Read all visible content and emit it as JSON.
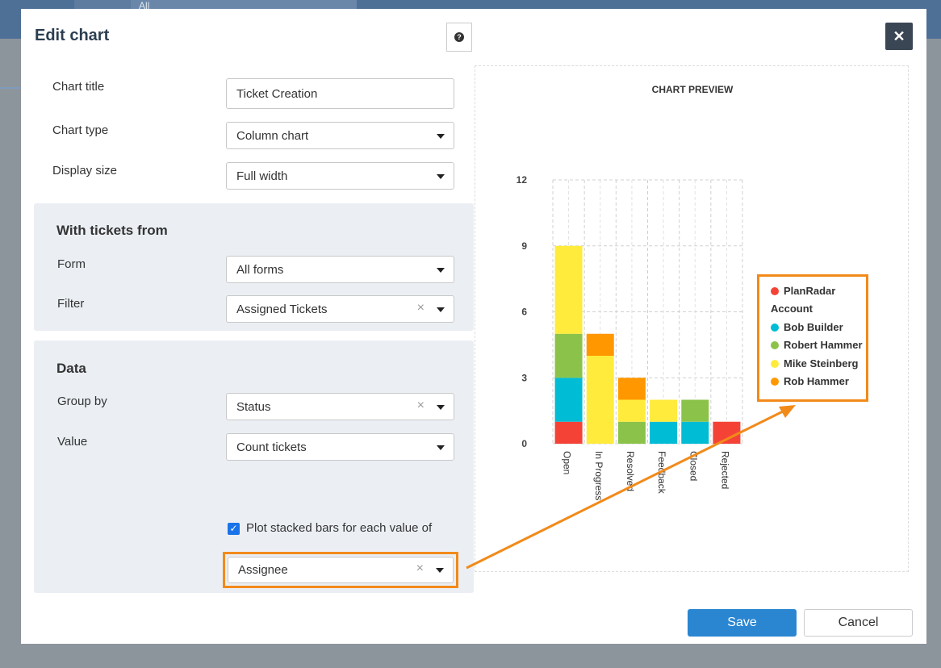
{
  "background": {
    "tab_label": "All"
  },
  "dialog": {
    "title": "Edit chart",
    "help_icon": "question-icon",
    "close_icon": "close-icon"
  },
  "form": {
    "chart_title_label": "Chart title",
    "chart_title_value": "Ticket Creation",
    "chart_type_label": "Chart type",
    "chart_type_value": "Column chart",
    "display_size_label": "Display size",
    "display_size_value": "Full width"
  },
  "tickets_section": {
    "title": "With tickets from",
    "form_label": "Form",
    "form_value": "All forms",
    "filter_label": "Filter",
    "filter_value": "Assigned Tickets"
  },
  "data_section": {
    "title": "Data",
    "group_by_label": "Group by",
    "group_by_value": "Status",
    "value_label": "Value",
    "value_value": "Count tickets",
    "stacked_label": "Plot stacked bars for each value of",
    "stacked_checked": true,
    "stacked_by_value": "Assignee"
  },
  "preview": {
    "title": "CHART PREVIEW"
  },
  "footer": {
    "save_label": "Save",
    "cancel_label": "Cancel"
  },
  "chart_data": {
    "type": "bar",
    "stacked": true,
    "categories": [
      "Open",
      "In Progress",
      "Resolved",
      "Feedback",
      "Closed",
      "Rejected"
    ],
    "ylim": [
      0,
      12
    ],
    "yticks": [
      0,
      3,
      6,
      9,
      12
    ],
    "grid": true,
    "legend_position": "right",
    "series": [
      {
        "name": "PlanRadar Account",
        "color": "#f44336",
        "values": [
          1,
          0,
          0,
          0,
          0,
          1
        ]
      },
      {
        "name": "Bob Builder",
        "color": "#00bcd4",
        "values": [
          2,
          0,
          0,
          1,
          1,
          0
        ]
      },
      {
        "name": "Robert Hammer",
        "color": "#8bc34a",
        "values": [
          2,
          0,
          1,
          0,
          1,
          0
        ]
      },
      {
        "name": "Mike Steinberg",
        "color": "#ffeb3b",
        "values": [
          4,
          4,
          1,
          1,
          0,
          0
        ]
      },
      {
        "name": "Rob Hammer",
        "color": "#ff9800",
        "values": [
          0,
          1,
          1,
          0,
          0,
          0
        ]
      }
    ]
  }
}
